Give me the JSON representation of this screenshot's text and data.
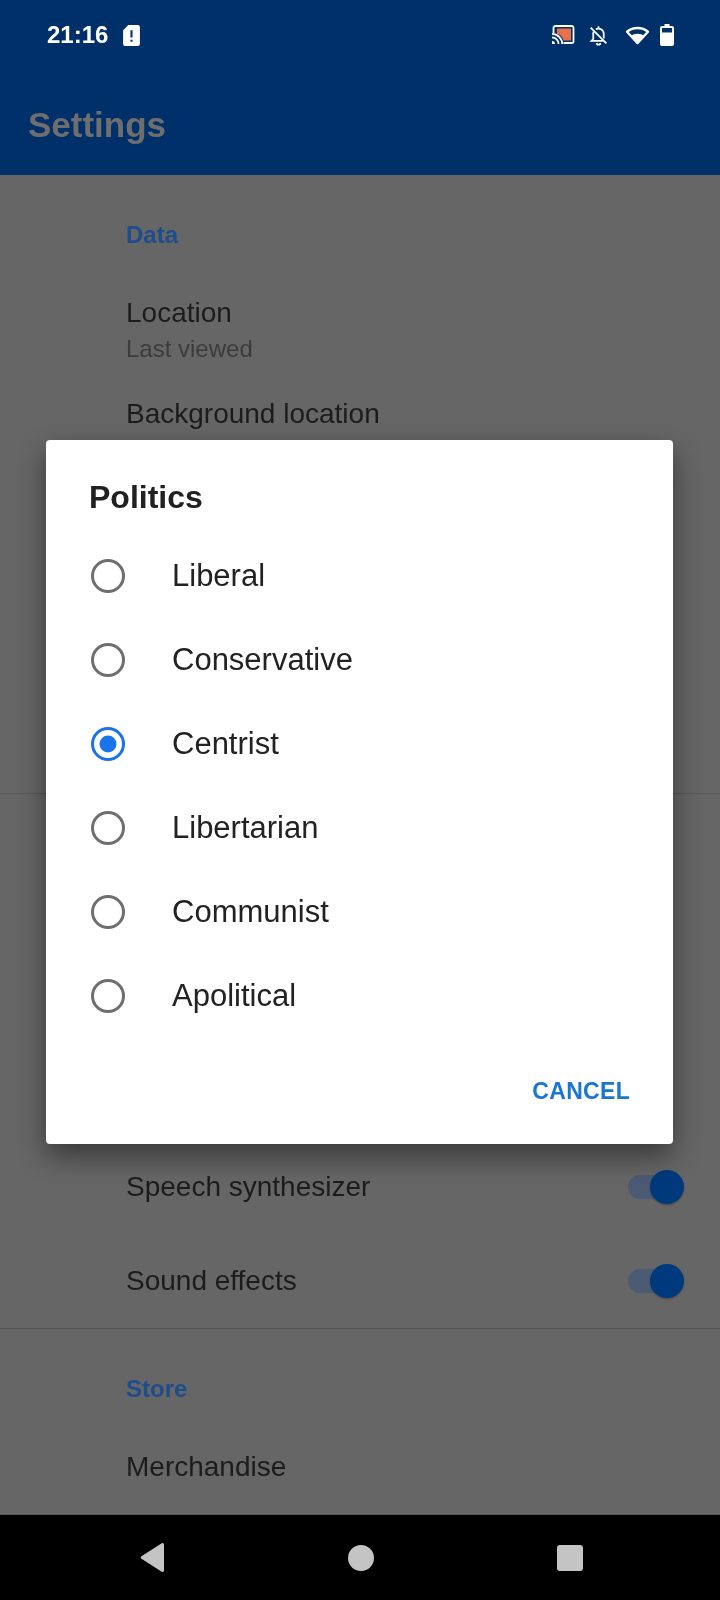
{
  "status_bar": {
    "time": "21:16"
  },
  "app_bar": {
    "title": "Settings"
  },
  "sections": [
    {
      "header": "Data",
      "items": [
        {
          "kind": "text",
          "title": "Location",
          "summary": "Last viewed"
        },
        {
          "kind": "text",
          "title": "Background location"
        }
      ]
    },
    {
      "items": [
        {
          "kind": "switch",
          "title": "Speech synthesizer",
          "on": true
        },
        {
          "kind": "switch",
          "title": "Sound effects",
          "on": true
        }
      ]
    },
    {
      "header": "Store",
      "items": [
        {
          "kind": "text",
          "title": "Merchandise"
        }
      ]
    }
  ],
  "dialog": {
    "title": "Politics",
    "options": [
      {
        "label": "Liberal",
        "selected": false
      },
      {
        "label": "Conservative",
        "selected": false
      },
      {
        "label": "Centrist",
        "selected": true
      },
      {
        "label": "Libertarian",
        "selected": false
      },
      {
        "label": "Communist",
        "selected": false
      },
      {
        "label": "Apolitical",
        "selected": false
      }
    ],
    "buttons": [
      "CANCEL"
    ]
  }
}
